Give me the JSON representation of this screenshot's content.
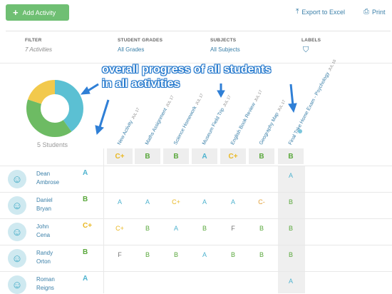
{
  "toolbar": {
    "add_label": "Add Activity",
    "export_label": "Export to Excel",
    "print_label": "Print"
  },
  "filters": {
    "filter_head": "FILTER",
    "filter_value": "7 Activities",
    "grades_head": "STUDENT GRADES",
    "grades_value": "All Grades",
    "subjects_head": "SUBJECTS",
    "subjects_value": "All Subjects",
    "labels_head": "LABELS"
  },
  "annotation": {
    "line1": "overall progress of all students",
    "line2": "in all activities"
  },
  "summary": {
    "students": "5 Students"
  },
  "donut": {
    "segments": [
      {
        "fraction": 0.4,
        "color": "#5bc0d3"
      },
      {
        "fraction": 0.4,
        "color": "#6dbb63"
      },
      {
        "fraction": 0.2,
        "color": "#f2c94c"
      }
    ]
  },
  "colors": {
    "A": "#4fb3cf",
    "B": "#5aa83c",
    "C+": "#e9b824",
    "C-": "#e2a13a",
    "F": "#777777"
  },
  "activities": [
    {
      "name": "New Activity",
      "date": "JUL 17",
      "average": "C+"
    },
    {
      "name": "Maths Assignment",
      "date": "JUL 17",
      "average": "B"
    },
    {
      "name": "Science Homework",
      "date": "JUL 17",
      "average": "B"
    },
    {
      "name": "Museum Field Trip",
      "date": "JUL 17",
      "average": "A"
    },
    {
      "name": "English Book Review",
      "date": "JUL 17",
      "average": "C+"
    },
    {
      "name": "Geography Map",
      "date": "JUL 17",
      "average": "B"
    },
    {
      "name": "Final Take Home Exam - Psychology",
      "date": "JUL 16",
      "average": "B"
    }
  ],
  "students": [
    {
      "first": "Dean",
      "last": "Ambrose",
      "grade": "A",
      "grades": [
        "",
        "",
        "",
        "",
        "",
        "",
        "A"
      ]
    },
    {
      "first": "Daniel",
      "last": "Bryan",
      "grade": "B",
      "grades": [
        "A",
        "A",
        "C+",
        "A",
        "A",
        "C-",
        "B"
      ]
    },
    {
      "first": "John",
      "last": "Cena",
      "grade": "C+",
      "grades": [
        "C+",
        "B",
        "A",
        "B",
        "F",
        "B",
        "B"
      ]
    },
    {
      "first": "Randy",
      "last": "Orton",
      "grade": "B",
      "grades": [
        "F",
        "B",
        "B",
        "A",
        "B",
        "B",
        "B"
      ]
    },
    {
      "first": "Roman",
      "last": "Reigns",
      "grade": "A",
      "grades": [
        "",
        "",
        "",
        "",
        "",
        "",
        "A"
      ]
    }
  ]
}
